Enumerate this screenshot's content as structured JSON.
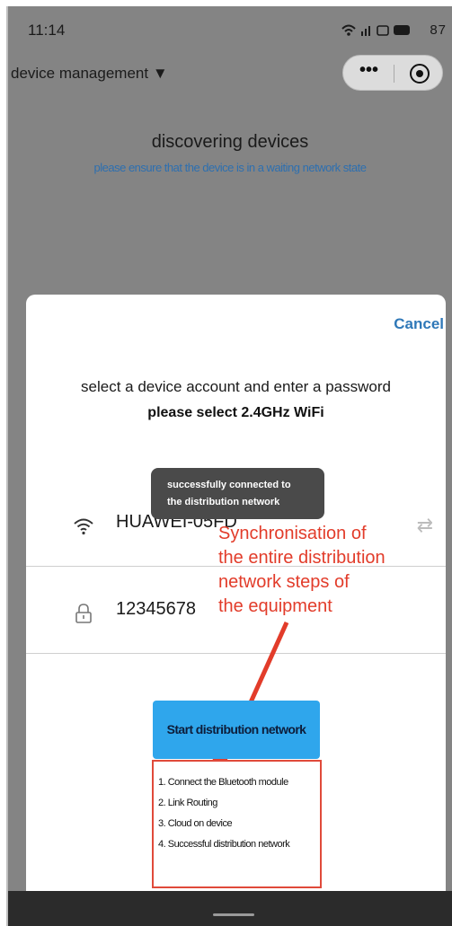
{
  "status": {
    "time": "11:14",
    "icons_text": "◉ .ıl ☎ ▮87",
    "battery": "87"
  },
  "nav": {
    "title": "device management ▼",
    "more_icon": "more-dots-icon",
    "close_icon": "target-icon"
  },
  "discover": {
    "title": "discovering devices",
    "subtitle": "please ensure that the device is in a waiting network state"
  },
  "modal": {
    "cancel_label": "Cancel",
    "title": "select a device account and enter a password",
    "subtitle": "please select 2.4GHz WiFi",
    "toast_line1": "successfully connected to",
    "toast_line2": "the distribution network",
    "wifi_name": "HUAWEI-05FD",
    "password": "12345678",
    "start_label": "Start distribution network"
  },
  "annotation": {
    "lines": [
      "Synchronisation of",
      "the entire distribution",
      "network steps of",
      "the equipment"
    ],
    "color": "#e23c2a"
  },
  "steps": [
    "1. Connect the Bluetooth module",
    "2. Link Routing",
    "3. Cloud on device",
    "4. Successful distribution network"
  ],
  "colors": {
    "accent": "#2fa6ec",
    "cancel": "#2f78b8",
    "subtitle": "#2d6fb0"
  }
}
